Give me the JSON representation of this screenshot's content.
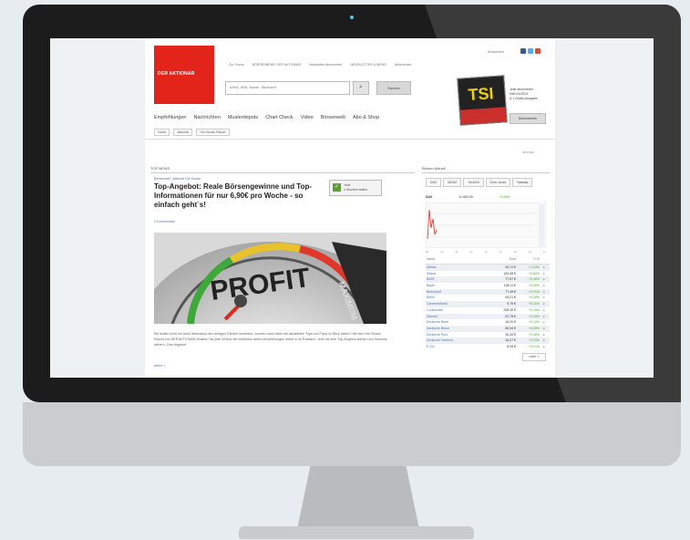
{
  "header": {
    "logo_text": "DER AKTIONÄR",
    "login": "Anmelden",
    "toplinks": [
      "Zur Suche",
      "BÖRSENBRIEF DER AKTIONÄR",
      "Newsletter Abonnieren",
      "NEWSLETTER & MEHR",
      "Aktienindex"
    ],
    "search_placeholder": "WKN, ISIN, Name, Stichwort",
    "search_button": "⌕",
    "search_secondary": "Suchen",
    "magazine_cover": "TSI",
    "magazine_lines": [
      "Jetzt abonnieren",
      "Heft 01/2024",
      "& 1 Gratis-Ausgabe"
    ]
  },
  "nav": {
    "items": [
      "Empfehlungen",
      "Nachrichten",
      "Musterdepots",
      "Chart Check",
      "Video",
      "Börsenwelt",
      "Abo & Shop"
    ],
    "button": "Börsenbriefe"
  },
  "subnav": [
    "Home",
    "Aktionär",
    "Hot Stocks Report"
  ],
  "misc": {
    "top_right": "Anzeige"
  },
  "article": {
    "section": "TOP NEWS",
    "crumb": "Börsenwelt · Aktionär Hot Stocks",
    "headline": "Top-Angebot: Reale Börsengewinne und Top-Informationen für nur 6,90€ pro Woche - so einfach geht´s!",
    "badge_icon": "✓",
    "badge_line1": "Jetzt",
    "badge_line2": "4 Wochen testen",
    "comments": "0 Kommentare",
    "image_text": "PROFIT",
    "image_text2": "MAXIMUM",
    "body": "Sie wollen nicht nur beim Aktienkauf den richtigen Riecher beweisen, sondern auch stets die aktuellsten Tops und Flops im Blick haben? Mit dem Hot Stocks Report von DER AKTIONÄR erhalten Sie jede Woche die heißesten Aktien-Empfehlungen direkt in Ihr Postfach. Jetzt mit dem Top-Angebot starten und Gewinne sichern. Zum Angebot.",
    "more": "weiter »"
  },
  "sidebar": {
    "title": "Börsen Aktuell",
    "tabs": [
      "DAX",
      "MDAX",
      "TecDAX",
      "Dow Jones",
      "Nasdaq"
    ],
    "index_name": "DAX",
    "index_value": "11.563,39",
    "index_change": "+0,55%",
    "axis": [
      "09",
      "10",
      "11",
      "12",
      "13",
      "14",
      "15",
      "16",
      "17"
    ],
    "table_headers": [
      "Name",
      "Kurs",
      "+/-%",
      ""
    ],
    "rows": [
      [
        "Adidas",
        "93,72 €",
        "+1,33%",
        "▸"
      ],
      [
        "Allianz",
        "152,08 €",
        "+0,82%",
        "▸"
      ],
      [
        "BASF",
        "77,67 €",
        "+0,46%",
        "▸"
      ],
      [
        "Bayer",
        "128,11 €",
        "+0,39%",
        "▸"
      ],
      [
        "Beiersdorf",
        "77,49 €",
        "+0,31%",
        "▸"
      ],
      [
        "BMW",
        "94,21 €",
        "+0,28%",
        "▸"
      ],
      [
        "Commerzbank",
        "9,75 €",
        "+0,21%",
        "▸"
      ],
      [
        "Continental",
        "205,30 €",
        "+0,19%",
        "▸"
      ],
      [
        "Daimler",
        "67,78 €",
        "+0,15%",
        "▸"
      ],
      [
        "Deutsche Bank",
        "16,20 €",
        "+0,12%",
        "▸"
      ],
      [
        "Deutsche Börse",
        "80,94 €",
        "+0,09%",
        "▸"
      ],
      [
        "Deutsche Post",
        "30,33 €",
        "+0,06%",
        "▸"
      ],
      [
        "Deutsche Telekom",
        "16,27 €",
        "+0,03%",
        "▸"
      ],
      [
        "E.ON",
        "8,95 €",
        "+0,01%",
        "▸"
      ]
    ],
    "more": "mehr »"
  },
  "colors": {
    "brand": "#e2241b",
    "link": "#5876a8",
    "positive": "#5aa32a"
  }
}
